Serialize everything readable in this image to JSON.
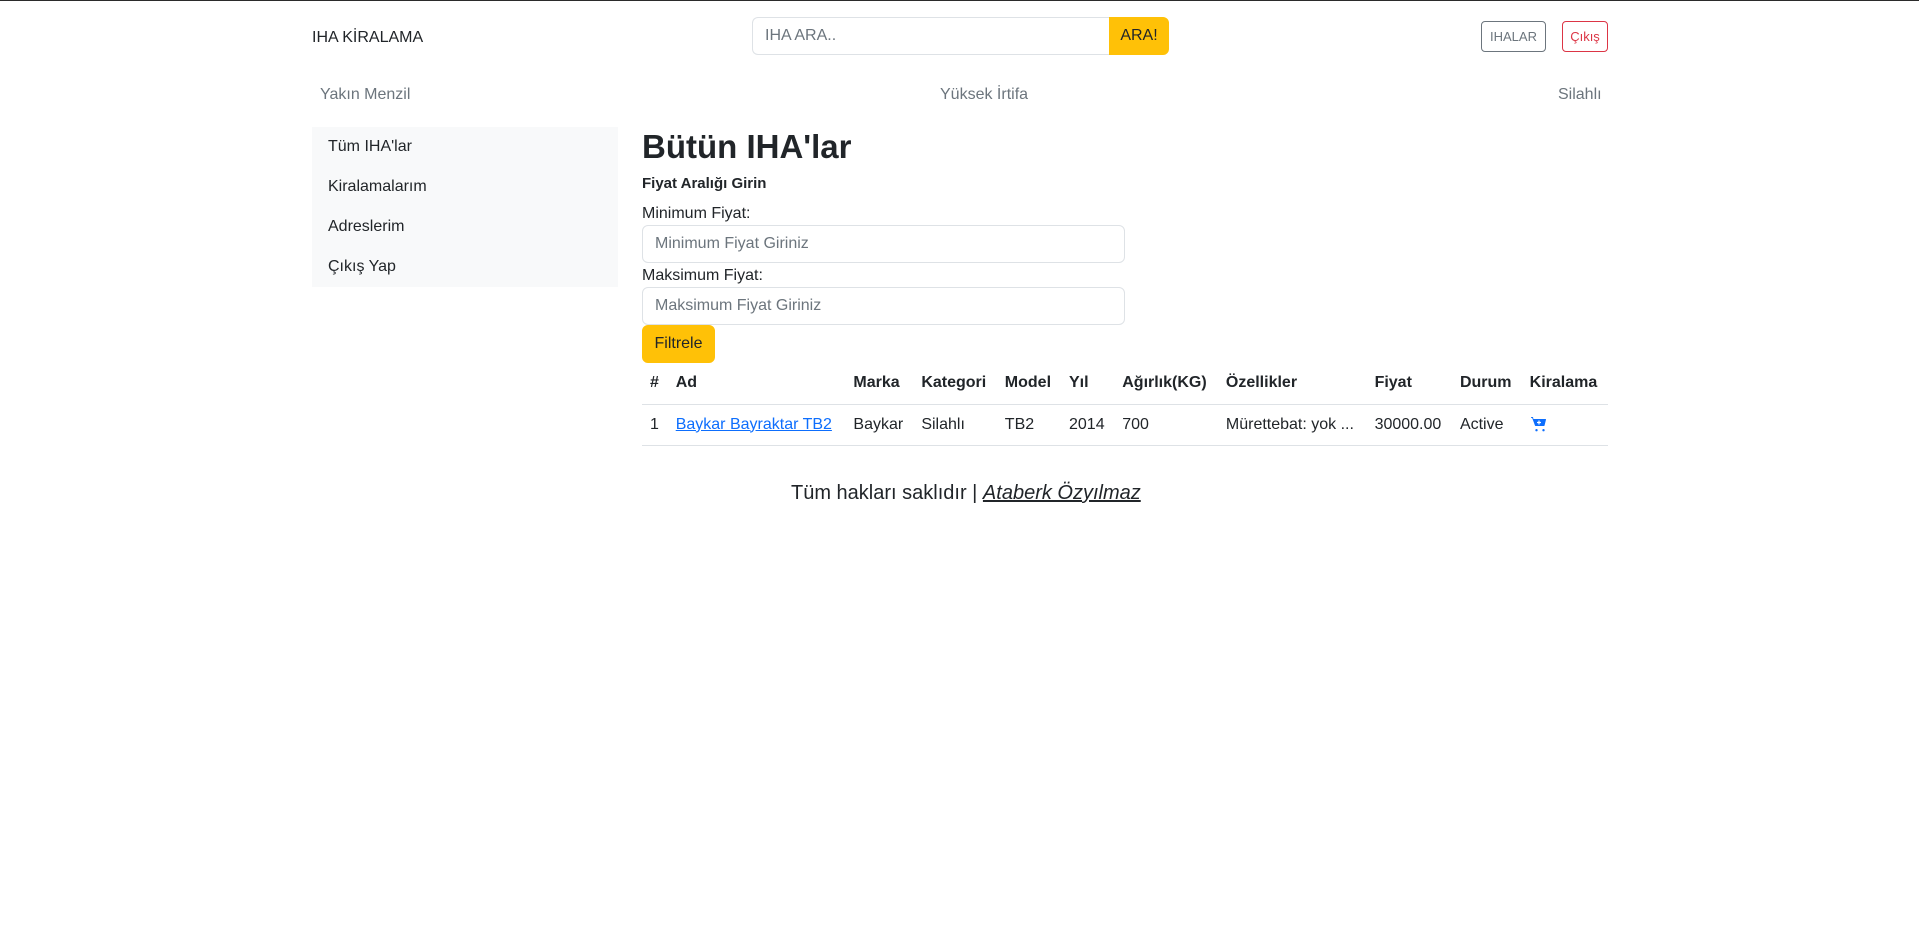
{
  "header": {
    "brand": "IHA KİRALAMA",
    "search": {
      "placeholder": "IHA ARA..",
      "value": "",
      "button_label": "ARA!"
    },
    "ihalar_label": "IHALAR",
    "logout_label": "Çıkış"
  },
  "category_nav": [
    "Yakın Menzil",
    "Yüksek İrtifa",
    "Silahlı"
  ],
  "sidebar": {
    "items": [
      {
        "label": "Tüm IHA'lar"
      },
      {
        "label": "Kiralamalarım"
      },
      {
        "label": "Adreslerim"
      },
      {
        "label": "Çıkış Yap"
      }
    ]
  },
  "main": {
    "title": "Bütün IHA'lar",
    "filter_heading": "Fiyat Aralığı Girin",
    "min_label": "Minimum Fiyat:",
    "min_placeholder": "Minimum Fiyat Giriniz",
    "max_label": "Maksimum Fiyat:",
    "max_placeholder": "Maksimum Fiyat Giriniz",
    "filter_button": "Filtrele"
  },
  "table": {
    "headers": [
      "#",
      "Ad",
      "Marka",
      "Kategori",
      "Model",
      "Yıl",
      "Ağırlık(KG)",
      "Özellikler",
      "Fiyat",
      "Durum",
      "Kiralama"
    ],
    "rows": [
      {
        "no": "1",
        "name": "Baykar Bayraktar TB2",
        "brand": "Baykar",
        "category": "Silahlı",
        "model": "TB2",
        "year": "2014",
        "weight": "700",
        "features": "Mürettebat: yok ...",
        "price": "30000.00",
        "status": "Active",
        "rent_icon": "cart-plus-icon"
      }
    ]
  },
  "footer": {
    "text": "Tüm hakları saklıdır | ",
    "author": "Ataberk Özyılmaz"
  },
  "colors": {
    "accent": "#ffc107",
    "link": "#0d6efd",
    "danger": "#dc3545",
    "muted": "#6c757d",
    "sidebar_bg": "#f8f9fa"
  }
}
